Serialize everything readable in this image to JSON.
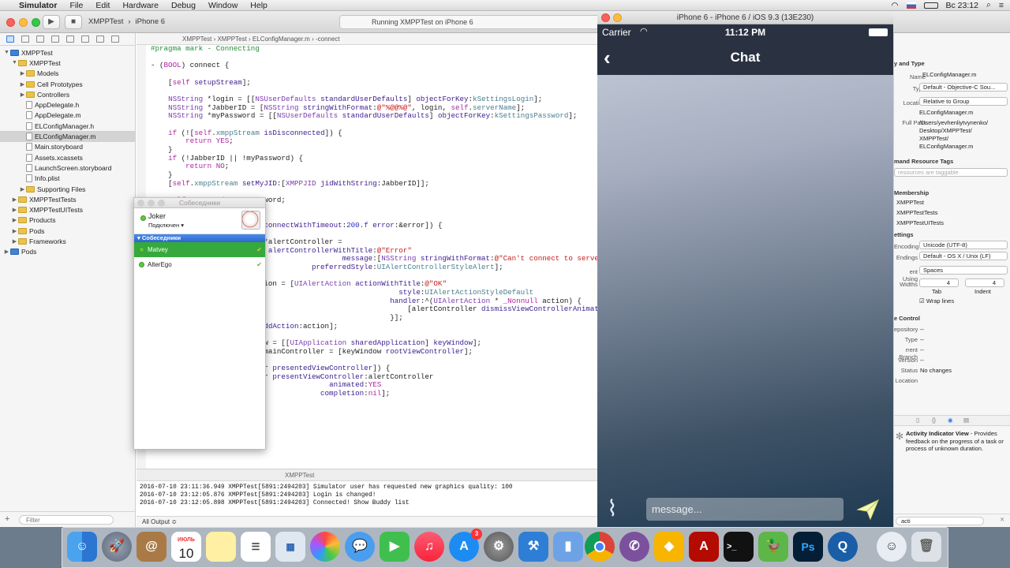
{
  "menubar": {
    "apple": "",
    "app_name": "Simulator",
    "items": [
      "File",
      "Edit",
      "Hardware",
      "Debug",
      "Window",
      "Help"
    ],
    "clock": "Вс 23:12"
  },
  "xcode": {
    "scheme": "XMPPTest",
    "device": "iPhone 6",
    "activity": "Running XMPPTest on iPhone 6",
    "navigator": [
      {
        "label": "XMPPTest",
        "depth": 0,
        "type": "proj",
        "open": true
      },
      {
        "label": "XMPPTest",
        "depth": 1,
        "type": "folder",
        "open": true
      },
      {
        "label": "Models",
        "depth": 2,
        "type": "folder",
        "open": false
      },
      {
        "label": "Cell Prototypes",
        "depth": 2,
        "type": "folder",
        "open": false
      },
      {
        "label": "Controllers",
        "depth": 2,
        "type": "folder",
        "open": false
      },
      {
        "label": "AppDelegate.h",
        "depth": 2,
        "type": "file"
      },
      {
        "label": "AppDelegate.m",
        "depth": 2,
        "type": "file"
      },
      {
        "label": "ELConfigManager.h",
        "depth": 2,
        "type": "file"
      },
      {
        "label": "ELConfigManager.m",
        "depth": 2,
        "type": "file",
        "selected": true
      },
      {
        "label": "Main.storyboard",
        "depth": 2,
        "type": "file"
      },
      {
        "label": "Assets.xcassets",
        "depth": 2,
        "type": "file"
      },
      {
        "label": "LaunchScreen.storyboard",
        "depth": 2,
        "type": "file"
      },
      {
        "label": "Info.plist",
        "depth": 2,
        "type": "file"
      },
      {
        "label": "Supporting Files",
        "depth": 2,
        "type": "folder",
        "open": false
      },
      {
        "label": "XMPPTestTests",
        "depth": 1,
        "type": "folder",
        "open": false
      },
      {
        "label": "XMPPTestUITests",
        "depth": 1,
        "type": "folder",
        "open": false
      },
      {
        "label": "Products",
        "depth": 1,
        "type": "folder",
        "open": false
      },
      {
        "label": "Pods",
        "depth": 1,
        "type": "folder",
        "open": false
      },
      {
        "label": "Frameworks",
        "depth": 1,
        "type": "folder",
        "open": false
      },
      {
        "label": "Pods",
        "depth": 0,
        "type": "proj",
        "open": false
      }
    ],
    "nav_filter_placeholder": "Filter",
    "jumpbar": [
      "XMPPTest",
      "XMPPTest",
      "ELConfigManager.m",
      "-connect"
    ],
    "debug_target": "XMPPTest",
    "console_lines": [
      "2016-07-10 23:11:36.949 XMPPTest[5891:2494203] Simulator user has requested new graphics quality: 100",
      "2016-07-10 23:12:05.876 XMPPTest[5891:2494203] Login is changed!",
      "2016-07-10 23:12:05.898 XMPPTest[5891:2494203] Connected! Show Buddy list"
    ],
    "console_filter": "All Output ≎",
    "inspector": {
      "identity_title": "y and Type",
      "name_label": "Name",
      "name_value": "ELConfigManager.m",
      "type_label": "Type",
      "type_value": "Default - Objective-C Sou...",
      "location_label": "Location",
      "location_value": "Relative to Group",
      "location_file": "ELConfigManager.m",
      "fullpath_label": "Full Path",
      "fullpath_lines": [
        "/Users/yevhenliytvynenko/",
        "Desktop/XMPPTest/",
        "XMPPTest/",
        "ELConfigManager.m"
      ],
      "odr_title": "mand Resource Tags",
      "odr_placeholder": "resources are taggable",
      "membership_title": "Membership",
      "targets": [
        "XMPPTest",
        "XMPPTestTests",
        "XMPPTestUITests"
      ],
      "settings_title": "ettings",
      "encoding_label": "Encoding",
      "encoding_value": "Unicode (UTF-8)",
      "endings_label": "Endings",
      "endings_value": "Default - OS X / Unix (LF)",
      "indent_label": "ent Using",
      "indent_value": "Spaces",
      "widths_label": "Widths",
      "tab_value": "4",
      "indent_width": "4",
      "tab_caption": "Tab",
      "indent_caption": "Indent",
      "wrap_label": "Wrap lines",
      "vc_title": "e Control",
      "vc_rows": [
        [
          "epository",
          "--"
        ],
        [
          "Type",
          "--"
        ],
        [
          "rrent Branch",
          "--"
        ],
        [
          "Version",
          "--"
        ],
        [
          "Status",
          "No changes"
        ],
        [
          "Location",
          ""
        ]
      ],
      "lib_title": "Activity Indicator View",
      "lib_desc": " - Provides feedback on the progress of a task or process of unknown duration.",
      "search_value": "acti"
    }
  },
  "buddy": {
    "title": "Собеседники",
    "user": "Joker",
    "status": "Подключен",
    "group": "Собеседники",
    "contacts": [
      "Matvey",
      "AlterEgo"
    ]
  },
  "simulator": {
    "title": "iPhone 6 - iPhone 6 / iOS 9.3 (13E230)",
    "carrier": "Carrier",
    "time": "11:12 PM",
    "nav_title": "Chat",
    "message_placeholder": "message..."
  },
  "dock": {
    "calendar_month": "ИЮЛЬ",
    "calendar_day": "10",
    "appstore_badge": "3"
  }
}
